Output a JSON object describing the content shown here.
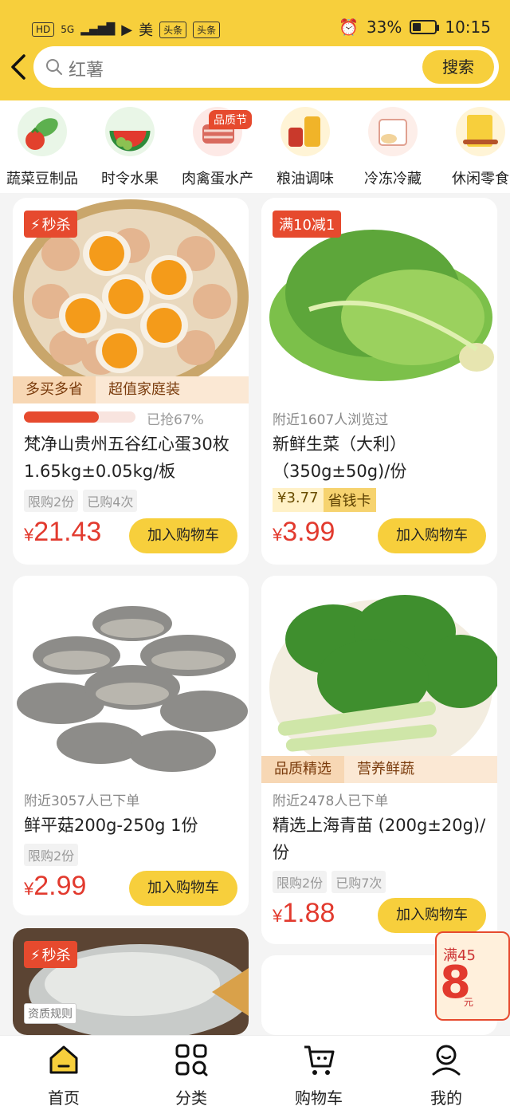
{
  "status_bar": {
    "left_tags": [
      "HD",
      "5G",
      "美",
      "头条",
      "头条"
    ],
    "battery": "33%",
    "time": "10:15"
  },
  "search": {
    "value": "红薯",
    "button": "搜索"
  },
  "categories": [
    {
      "label": "蔬菜豆制品",
      "icon": "vegetable-icon"
    },
    {
      "label": "时令水果",
      "icon": "watermelon-icon"
    },
    {
      "label": "肉禽蛋水产",
      "icon": "meat-icon",
      "badge": "品质节"
    },
    {
      "label": "粮油调味",
      "icon": "oil-icon"
    },
    {
      "label": "冷冻冷藏",
      "icon": "frozen-icon"
    },
    {
      "label": "休闲零食",
      "icon": "snack-icon"
    }
  ],
  "products": [
    {
      "tag": "秒杀",
      "subtags": [
        "多买多省",
        "超值家庭装"
      ],
      "progress_text": "已抢67%",
      "progress_pct": 67,
      "title": "梵净山贵州五谷红心蛋30枚 1.65kg±0.05kg/板",
      "chips": [
        "限购2份",
        "已购4次"
      ],
      "price": "21.43",
      "button": "加入购物车"
    },
    {
      "tag": "满10减1",
      "meta": "附近1607人浏览过",
      "title": "新鲜生菜（大利）（350g±50g)/份",
      "saver_price": "¥3.77",
      "saver_label": "省钱卡",
      "price": "3.99",
      "button": "加入购物车"
    },
    {
      "meta": "附近3057人已下单",
      "title": "鲜平菇200g-250g 1份",
      "chips": [
        "限购2份"
      ],
      "price": "2.99",
      "button": "加入购物车"
    },
    {
      "subtags": [
        "品质精选",
        "营养鲜蔬"
      ],
      "meta": "附近2478人已下单",
      "title": "精选上海青苗 (200g±20g)/份",
      "chips": [
        "限购2份",
        "已购7次"
      ],
      "price": "1.88",
      "button": "加入购物车"
    },
    {
      "tag": "秒杀",
      "qual": "资质规则"
    }
  ],
  "currency": "¥",
  "coupon": {
    "top": "满45",
    "amount": "8",
    "unit": "元"
  },
  "nav": [
    {
      "label": "首页",
      "icon": "home-icon"
    },
    {
      "label": "分类",
      "icon": "category-icon"
    },
    {
      "label": "购物车",
      "icon": "cart-icon"
    },
    {
      "label": "我的",
      "icon": "profile-icon"
    }
  ]
}
